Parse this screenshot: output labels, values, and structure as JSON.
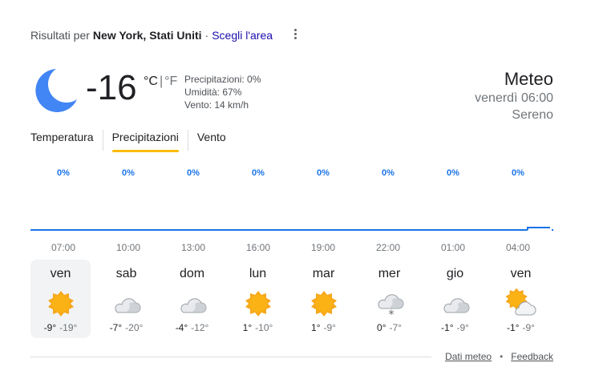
{
  "header": {
    "prefix": "Risultati per",
    "location": "New York, Stati Uniti",
    "separator": "·",
    "change_area": "Scegli l'area"
  },
  "current": {
    "icon": "moon-icon",
    "temperature": "-16",
    "unit_c": "°C",
    "unit_sep": "|",
    "unit_f": "°F",
    "precipitation": "Precipitazioni: 0%",
    "humidity": "Umidità: 67%",
    "wind": "Vento: 14 km/h"
  },
  "summary": {
    "title": "Meteo",
    "datetime": "venerdì 06:00",
    "condition": "Sereno"
  },
  "tabs": [
    {
      "label": "Temperatura",
      "active": false
    },
    {
      "label": "Precipitazioni",
      "active": true
    },
    {
      "label": "Vento",
      "active": false
    }
  ],
  "chart_data": {
    "type": "area",
    "x": [
      "07:00",
      "10:00",
      "13:00",
      "16:00",
      "19:00",
      "22:00",
      "01:00",
      "04:00"
    ],
    "values": [
      0,
      0,
      0,
      0,
      0,
      0,
      0,
      0
    ],
    "labels": [
      "0%",
      "0%",
      "0%",
      "0%",
      "0%",
      "0%",
      "0%",
      "0%"
    ],
    "color": "#1a73e8"
  },
  "days": [
    {
      "name": "ven",
      "icon": "sun-icon",
      "high": "-9°",
      "low": "-19°",
      "selected": true
    },
    {
      "name": "sab",
      "icon": "cloud-icon",
      "high": "-7°",
      "low": "-20°",
      "selected": false
    },
    {
      "name": "dom",
      "icon": "cloud-icon",
      "high": "-4°",
      "low": "-12°",
      "selected": false
    },
    {
      "name": "lun",
      "icon": "sun-icon",
      "high": "1°",
      "low": "-10°",
      "selected": false
    },
    {
      "name": "mar",
      "icon": "sun-icon",
      "high": "1°",
      "low": "-9°",
      "selected": false
    },
    {
      "name": "mer",
      "icon": "snow-cloud-icon",
      "high": "0°",
      "low": "-7°",
      "selected": false
    },
    {
      "name": "gio",
      "icon": "cloud-icon",
      "high": "-1°",
      "low": "-9°",
      "selected": false
    },
    {
      "name": "ven",
      "icon": "partly-cloudy-icon",
      "high": "-1°",
      "low": "-9°",
      "selected": false
    }
  ],
  "footer": {
    "source": "Dati meteo",
    "bullet": "•",
    "feedback": "Feedback"
  },
  "colors": {
    "accent": "#fbbc04",
    "link": "#1a0dab",
    "chart": "#1a73e8",
    "moon": "#4285f4"
  }
}
